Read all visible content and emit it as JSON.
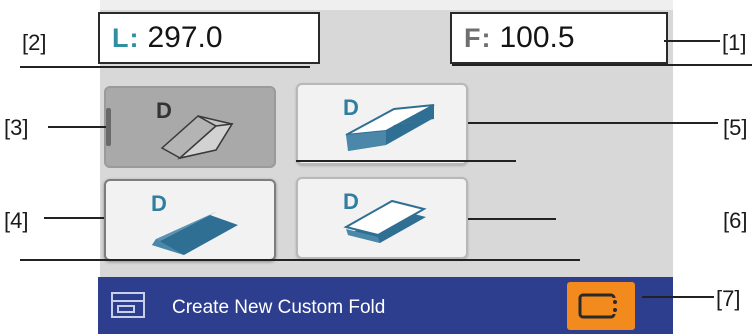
{
  "fields": {
    "length": {
      "prefix": "L:",
      "value": "297.0"
    },
    "fold": {
      "prefix": "F:",
      "value": "100.5"
    }
  },
  "tiles": [
    {
      "label": "D",
      "state": "selected",
      "icon": "tent-fold-icon"
    },
    {
      "label": "D",
      "state": "normal",
      "icon": "z-fold-icon"
    },
    {
      "label": "D",
      "state": "active",
      "icon": "single-fold-icon"
    },
    {
      "label": "D",
      "state": "normal",
      "icon": "flat-stack-icon"
    }
  ],
  "footer": {
    "create_label": "Create New Custom Fold",
    "fold_icon": "custom-fold-icon",
    "action_icon": "exit-icon"
  },
  "callouts": {
    "c1": "[1]",
    "c2": "[2]",
    "c3": "[3]",
    "c4": "[4]",
    "c5": "[5]",
    "c6": "[6]",
    "c7": "[7]"
  },
  "colors": {
    "accent_teal": "#2e8fa0",
    "paper_blue": "#2f6f94",
    "footer_blue": "#2d3e8f",
    "orange": "#f28a1e"
  }
}
